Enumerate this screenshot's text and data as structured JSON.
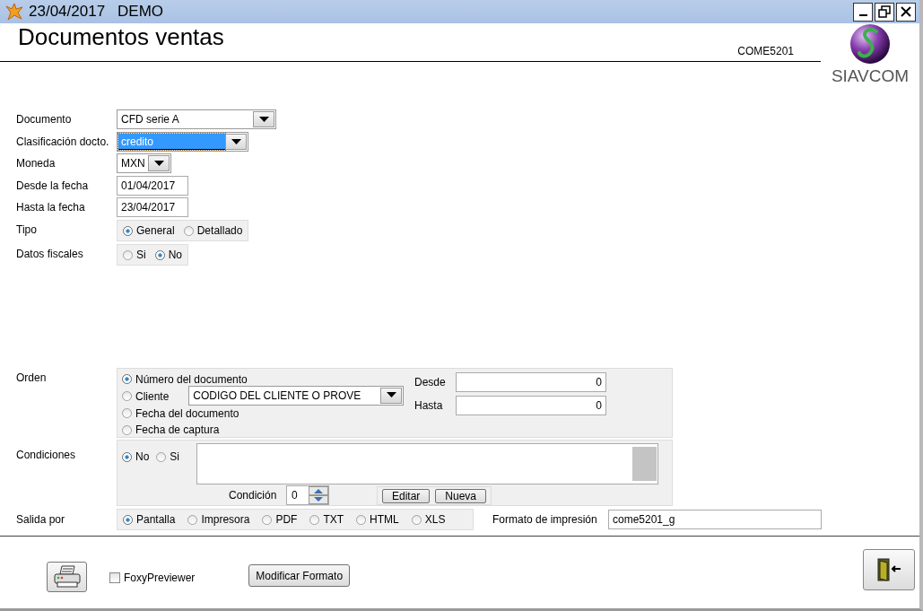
{
  "window": {
    "date": "23/04/2017",
    "company": "DEMO"
  },
  "header": {
    "title": "Documentos ventas",
    "code": "COME5201",
    "logo_text": "SIAVCOM"
  },
  "fields": [
    {
      "kind": "combo",
      "label": "Documento",
      "value": "CFD serie A",
      "highlighted": false
    },
    {
      "kind": "combo",
      "label": "Clasificación docto.",
      "value": "credito",
      "highlighted": true
    },
    {
      "kind": "combo",
      "label": "Moneda",
      "value": "MXN",
      "highlighted": false
    },
    {
      "kind": "text",
      "label": "Desde la fecha",
      "value": "01/04/2017"
    },
    {
      "kind": "text",
      "label": "Hasta la fecha",
      "value": "23/04/2017"
    },
    {
      "kind": "radio",
      "label": "Tipo",
      "options": [
        {
          "label": "General",
          "selected": true
        },
        {
          "label": "Detallado",
          "selected": false
        }
      ]
    },
    {
      "kind": "radio",
      "label": "Datos fiscales",
      "options": [
        {
          "label": "Si",
          "selected": false
        },
        {
          "label": "No",
          "selected": true
        }
      ]
    }
  ],
  "orden": {
    "label": "Orden",
    "options": [
      {
        "label": "Número del documento",
        "selected": true
      },
      {
        "label": "Cliente",
        "selected": false
      },
      {
        "label": "Fecha del documento",
        "selected": false
      },
      {
        "label": "Fecha de captura",
        "selected": false
      }
    ],
    "client_combo": "CODIGO DEL CLIENTE O PROVE",
    "desde": {
      "label": "Desde",
      "value": "0"
    },
    "hasta": {
      "label": "Hasta",
      "value": "0"
    }
  },
  "condiciones": {
    "label": "Condiciones",
    "options": [
      {
        "label": "No",
        "selected": true
      },
      {
        "label": "Si",
        "selected": false
      }
    ],
    "condition_label": "Condición",
    "condition_value": "0",
    "buttons": [
      "Editar",
      "Nueva"
    ]
  },
  "salida": {
    "label": "Salida por",
    "options": [
      {
        "label": "Pantalla",
        "selected": true
      },
      {
        "label": "Impresora",
        "selected": false
      },
      {
        "label": "PDF",
        "selected": false
      },
      {
        "label": "TXT",
        "selected": false
      },
      {
        "label": "HTML",
        "selected": false
      },
      {
        "label": "XLS",
        "selected": false
      }
    ],
    "format_label": "Formato de impresión",
    "format_value": "come5201_g"
  },
  "bottom": {
    "foxy": {
      "label": "FoxyPreviewer",
      "checked": false
    },
    "modify_button": "Modificar Formato"
  }
}
